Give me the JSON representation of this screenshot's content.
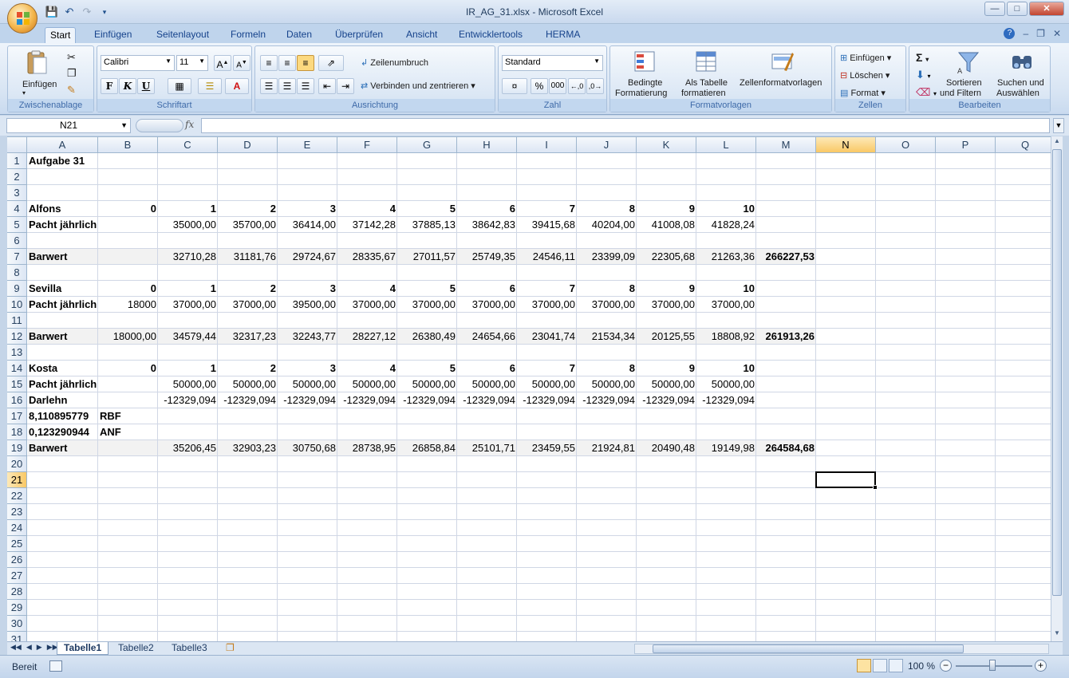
{
  "window": {
    "title": "IR_AG_31.xlsx - Microsoft Excel"
  },
  "ribbon_tabs": [
    "Start",
    "Einfügen",
    "Seitenlayout",
    "Formeln",
    "Daten",
    "Überprüfen",
    "Ansicht",
    "Entwicklertools",
    "HERMA"
  ],
  "ribbon": {
    "clipboard": {
      "paste": "Einfügen",
      "label": "Zwischenablage"
    },
    "font": {
      "name": "Calibri",
      "size": "11",
      "bold": "F",
      "italic": "K",
      "underline": "U",
      "label": "Schriftart"
    },
    "alignment": {
      "wrap": "Zeilenumbruch",
      "merge": "Verbinden und zentrieren",
      "label": "Ausrichtung"
    },
    "number": {
      "format": "Standard",
      "percent": "%",
      "thousands": "000",
      "label": "Zahl"
    },
    "styles": {
      "conditional_1": "Bedingte",
      "conditional_2": "Formatierung",
      "table_1": "Als Tabelle",
      "table_2": "formatieren",
      "cellstyles": "Zellenformatvorlagen",
      "label": "Formatvorlagen"
    },
    "cells": {
      "insert": "Einfügen",
      "delete": "Löschen",
      "format": "Format",
      "label": "Zellen"
    },
    "editing": {
      "sort_1": "Sortieren",
      "sort_2": "und Filtern",
      "find_1": "Suchen und",
      "find_2": "Auswählen",
      "label": "Bearbeiten"
    }
  },
  "formula_bar": {
    "name_box": "N21",
    "fx": "fx",
    "formula": ""
  },
  "columns": [
    "A",
    "B",
    "C",
    "D",
    "E",
    "F",
    "G",
    "H",
    "I",
    "J",
    "K",
    "L",
    "M",
    "N",
    "O",
    "P",
    "Q"
  ],
  "selected_column": "N",
  "selected_row": 21,
  "rows": [
    1,
    2,
    3,
    4,
    5,
    6,
    7,
    8,
    9,
    10,
    11,
    12,
    13,
    14,
    15,
    16,
    17,
    18,
    19,
    20,
    21,
    22,
    23,
    24,
    25,
    26,
    27,
    28,
    29,
    30,
    31
  ],
  "cells": {
    "r1": {
      "A": "Aufgabe 31"
    },
    "r4": {
      "A": "Alfons",
      "B": "0",
      "C": "1",
      "D": "2",
      "E": "3",
      "F": "4",
      "G": "5",
      "H": "6",
      "I": "7",
      "J": "8",
      "K": "9",
      "L": "10"
    },
    "r5": {
      "A": "Pacht jährlich",
      "C": "35000,00",
      "D": "35700,00",
      "E": "36414,00",
      "F": "37142,28",
      "G": "37885,13",
      "H": "38642,83",
      "I": "39415,68",
      "J": "40204,00",
      "K": "41008,08",
      "L": "41828,24"
    },
    "r7": {
      "A": "Barwert",
      "C": "32710,28",
      "D": "31181,76",
      "E": "29724,67",
      "F": "28335,67",
      "G": "27011,57",
      "H": "25749,35",
      "I": "24546,11",
      "J": "23399,09",
      "K": "22305,68",
      "L": "21263,36",
      "M": "266227,53"
    },
    "r9": {
      "A": "Sevilla",
      "B": "0",
      "C": "1",
      "D": "2",
      "E": "3",
      "F": "4",
      "G": "5",
      "H": "6",
      "I": "7",
      "J": "8",
      "K": "9",
      "L": "10"
    },
    "r10": {
      "A": "Pacht jährlich",
      "B": "18000",
      "C": "37000,00",
      "D": "37000,00",
      "E": "39500,00",
      "F": "37000,00",
      "G": "37000,00",
      "H": "37000,00",
      "I": "37000,00",
      "J": "37000,00",
      "K": "37000,00",
      "L": "37000,00"
    },
    "r12": {
      "A": "Barwert",
      "B": "18000,00",
      "C": "34579,44",
      "D": "32317,23",
      "E": "32243,77",
      "F": "28227,12",
      "G": "26380,49",
      "H": "24654,66",
      "I": "23041,74",
      "J": "21534,34",
      "K": "20125,55",
      "L": "18808,92",
      "M": "261913,26"
    },
    "r14": {
      "A": "Kosta",
      "B": "0",
      "C": "1",
      "D": "2",
      "E": "3",
      "F": "4",
      "G": "5",
      "H": "6",
      "I": "7",
      "J": "8",
      "K": "9",
      "L": "10"
    },
    "r15": {
      "A": "Pacht jährlich",
      "C": "50000,00",
      "D": "50000,00",
      "E": "50000,00",
      "F": "50000,00",
      "G": "50000,00",
      "H": "50000,00",
      "I": "50000,00",
      "J": "50000,00",
      "K": "50000,00",
      "L": "50000,00"
    },
    "r16": {
      "A": "Darlehn",
      "C": "-12329,094",
      "D": "-12329,094",
      "E": "-12329,094",
      "F": "-12329,094",
      "G": "-12329,094",
      "H": "-12329,094",
      "I": "-12329,094",
      "J": "-12329,094",
      "K": "-12329,094",
      "L": "-12329,094"
    },
    "r17": {
      "A": "8,110895779",
      "B": "RBF"
    },
    "r18": {
      "A": "0,123290944",
      "B": "ANF"
    },
    "r19": {
      "A": "Barwert",
      "C": "35206,45",
      "D": "32903,23",
      "E": "30750,68",
      "F": "28738,95",
      "G": "26858,84",
      "H": "25101,71",
      "I": "23459,55",
      "J": "21924,81",
      "K": "20490,48",
      "L": "19149,98",
      "M": "264584,68"
    }
  },
  "sheet_tabs": [
    "Tabelle1",
    "Tabelle2",
    "Tabelle3"
  ],
  "active_sheet": "Tabelle1",
  "status": {
    "ready": "Bereit",
    "zoom": "100 %"
  }
}
